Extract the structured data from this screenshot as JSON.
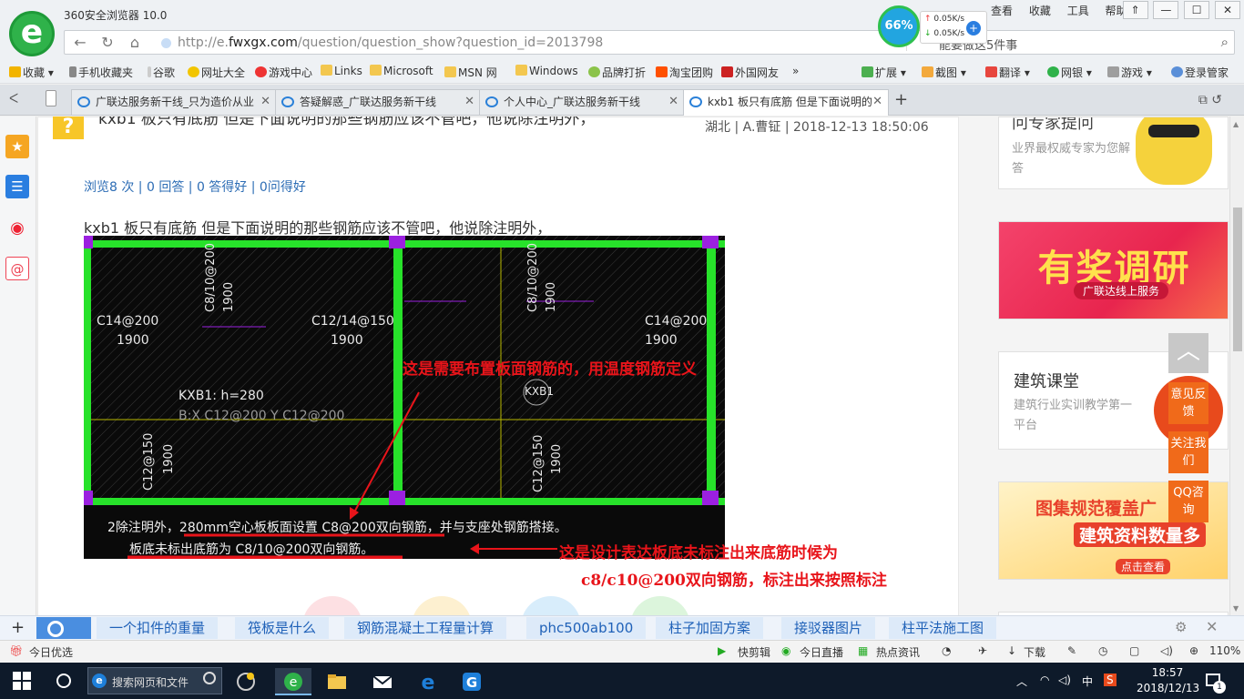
{
  "browser": {
    "app_title": "360安全浏览器 10.0",
    "url_prefix": "http://e.",
    "url_domain": "fwxgx.com",
    "url_path": "/question/question_show?question_id=2013798",
    "search_hint": "能要做这5件事",
    "menu": [
      "查看",
      "收藏",
      "工具",
      "帮助"
    ],
    "speed_percent": "66%",
    "speed_up": "0.05K/s",
    "speed_down": "0.05K/s"
  },
  "bookmarks": [
    "收藏",
    "手机收藏夹",
    "谷歌",
    "网址大全",
    "游戏中心",
    "Links",
    "Microsoft",
    "MSN 网",
    "Windows",
    "品牌打折",
    "淘宝团购",
    "外国网友"
  ],
  "extensions": [
    "扩展",
    "截图",
    "翻译",
    "网银",
    "游戏",
    "登录管家"
  ],
  "tabs": [
    "广联达服务新干线_只为造价从业",
    "答疑解惑_广联达服务新干线",
    "个人中心_广联达服务新干线",
    "kxb1 板只有底筋 但是下面说明的"
  ],
  "question": {
    "title": "kxb1 板只有底筋 但是下面说明的那些钢筋应该不管吧，他说除注明外，",
    "meta": "湖北 | A.曹钲 | 2018-12-13 18:50:06",
    "stats": "浏览8 次 | 0 回答 | 0 答得好 | 0问得好",
    "body": "kxb1 板只有底筋 但是下面说明的那些钢筋应该不管吧，他说除注明外，"
  },
  "cad": {
    "labels": {
      "c14_left": "C14@200",
      "n1900_left": "1900",
      "c12_14": "C12/14@150",
      "n1900_mid": "1900",
      "c14_right": "C14@200",
      "n1900_right": "1900",
      "kxb1_h": "KXB1: h=280",
      "kxb1_bxy": "B:X C12@200 Y C12@200",
      "kxb1_circle": "KXB1"
    },
    "vlabels": {
      "c8_top_left": "C8/10@200",
      "n1900_top_left": "1900",
      "c8_top_right": "C8/10@200",
      "n1900_top_right": "1900",
      "c12_bottom_left": "C12@150",
      "n1900_bottom_left": "1900",
      "c12_bottom_right": "C12@150",
      "n1900_bottom_right": "1900"
    },
    "note_line2": "2除注明外，280mm空心板板面设置 C8@200双向钢筋，并与支座处钢筋搭接。",
    "note_line3": "板底未标出底筋为 C8/10@200双向钢筋。",
    "annotation_top": "这是需要布置板面钢筋的，用温度钢筋定义",
    "annotation_bottom_1": "这是设计表达板底未标注出来底筋时候为",
    "annotation_bottom_2": "c8/c10@200双向钢筋，标注出来按照标注"
  },
  "sidebar_cards": {
    "expert_title": "问专家提问",
    "expert_sub": "业界最权威专家为您解答",
    "survey_title": "有奖调研",
    "survey_sub": "广联达线上服务",
    "course_title": "建筑课堂",
    "course_sub": "建筑行业实训教学第一平台",
    "atlas_l1": "图集规范覆盖广",
    "atlas_l2": "建筑资料数量多",
    "atlas_link": "点击查看"
  },
  "float_buttons": [
    "意见反馈",
    "关注我们",
    "QQ咨询"
  ],
  "hot_links": [
    "一个扣件的重量",
    "筏板是什么",
    "钢筋混凝土工程量计算",
    "phc500ab100",
    "柱子加固方案",
    "接驳器图片",
    "柱平法施工图"
  ],
  "status_bar": {
    "today": "今日优选",
    "items": [
      "快剪辑",
      "今日直播",
      "热点资讯",
      "下载"
    ],
    "zoom": "110%"
  },
  "taskbar": {
    "search_placeholder": "搜索网页和文件",
    "ime": "中",
    "time": "18:57",
    "date": "2018/12/13",
    "notify_count": "1"
  },
  "colors": {
    "cad_green": "#27e22a",
    "cad_purple": "#9b20e0",
    "annotation_red": "#e8141a",
    "link_blue": "#2d6db5"
  }
}
